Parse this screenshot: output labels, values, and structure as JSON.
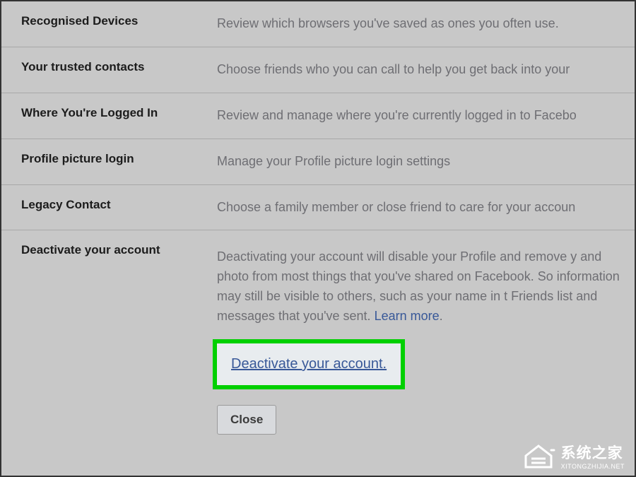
{
  "settings": {
    "recognised_devices": {
      "label": "Recognised Devices",
      "description": "Review which browsers you've saved as ones you often use."
    },
    "trusted_contacts": {
      "label": "Your trusted contacts",
      "description": "Choose friends who you can call to help you get back into your"
    },
    "logged_in": {
      "label": "Where You're Logged In",
      "description": "Review and manage where you're currently logged in to Facebo"
    },
    "profile_picture": {
      "label": "Profile picture login",
      "description": "Manage your Profile picture login settings"
    },
    "legacy_contact": {
      "label": "Legacy Contact",
      "description": "Choose a family member or close friend to care for your accoun"
    },
    "deactivate": {
      "label": "Deactivate your account",
      "expanded_text": "Deactivating your account will disable your Profile and remove y and photo from most things that you've shared on Facebook. So information may still be visible to others, such as your name in t Friends list and messages that you've sent. ",
      "learn_more": "Learn more",
      "deactivate_link": "Deactivate your account.",
      "close_button": "Close"
    }
  },
  "watermark": {
    "cn": "系统之家",
    "en": "XITONGZHIJIA.NET"
  }
}
